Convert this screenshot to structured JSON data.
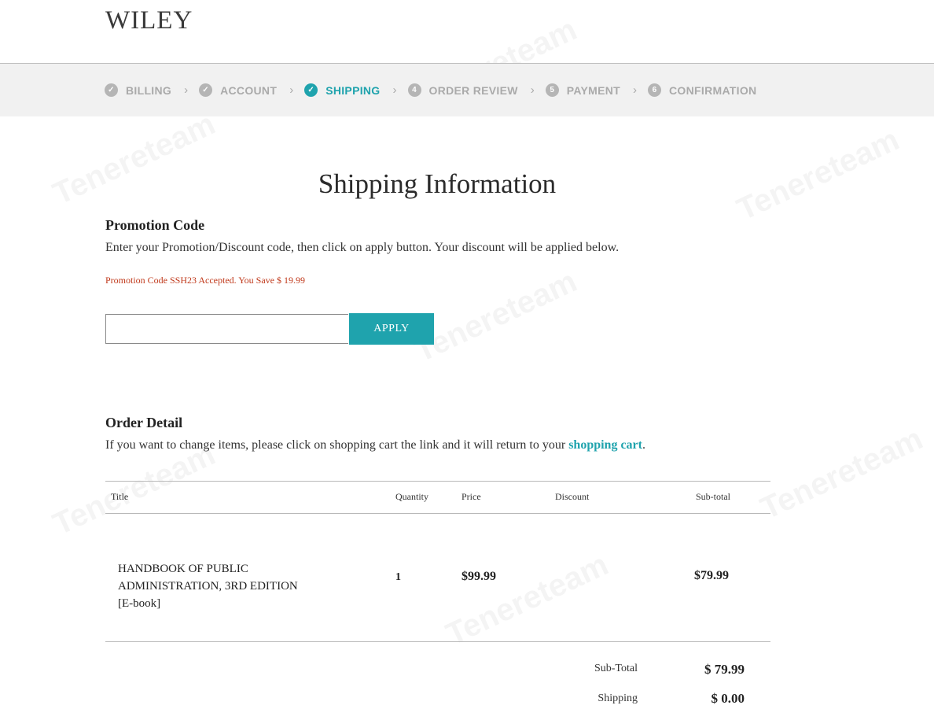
{
  "brand": {
    "logo": "WILEY"
  },
  "steps": [
    {
      "label": "BILLING",
      "state": "done"
    },
    {
      "label": "ACCOUNT",
      "state": "done"
    },
    {
      "label": "SHIPPING",
      "state": "active"
    },
    {
      "label": "ORDER REVIEW",
      "number": "4",
      "state": "pending"
    },
    {
      "label": "PAYMENT",
      "number": "5",
      "state": "pending"
    },
    {
      "label": "CONFIRMATION",
      "number": "6",
      "state": "pending"
    }
  ],
  "page": {
    "title": "Shipping Information"
  },
  "promotion": {
    "heading": "Promotion Code",
    "description": "Enter your Promotion/Discount code, then click on apply button. Your discount will be applied below.",
    "message": "Promotion Code SSH23 Accepted. You Save $ 19.99",
    "input_value": "",
    "apply_label": "APPLY"
  },
  "order": {
    "heading": "Order Detail",
    "description_prefix": "If you want to change items, please click on shopping cart the link and it will return to your ",
    "cart_link": "shopping cart",
    "description_suffix": ".",
    "columns": {
      "title": "Title",
      "quantity": "Quantity",
      "price": "Price",
      "discount": "Discount",
      "subtotal": "Sub-total"
    },
    "items": [
      {
        "title_line1": "HANDBOOK OF PUBLIC",
        "title_line2": "ADMINISTRATION, 3RD EDITION",
        "format": "[E-book]",
        "quantity": "1",
        "price": "$99.99",
        "discount": "",
        "subtotal": "$79.99"
      }
    ],
    "summary": {
      "subtotal_label": "Sub-Total",
      "subtotal_value": "$ 79.99",
      "shipping_label": "Shipping",
      "shipping_value": "$ 0.00"
    }
  },
  "watermark": "Tenereteam",
  "colors": {
    "accent": "#1fa3ad",
    "success_message": "#c0391b",
    "step_inactive": "#aaaaaa"
  },
  "icons": {
    "done": "check-circle-icon",
    "active": "check-circle-icon",
    "separator": "chevron-right-icon"
  }
}
